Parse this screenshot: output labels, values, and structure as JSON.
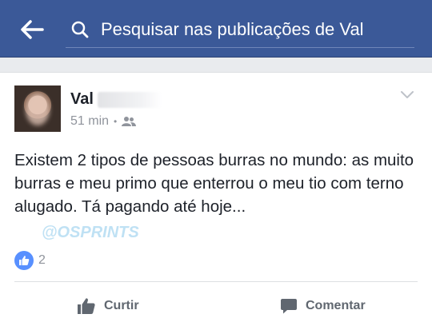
{
  "search": {
    "placeholder": "Pesquisar nas publicações de Val"
  },
  "post": {
    "author": "Val",
    "time": "51 min",
    "separator": "•",
    "text": "Existem 2 tipos de pessoas burras no mundo: as muito burras e meu primo que enterrou o meu tio com terno alugado. Tá pagando até hoje...",
    "watermark": "@OSPRINTS",
    "like_count": "2"
  },
  "actions": {
    "like_label": "Curtir",
    "comment_label": "Comentar"
  },
  "icons": {
    "back": "arrow-left-icon",
    "search": "search-icon",
    "privacy": "friends-icon",
    "menu": "chevron-down-icon",
    "reaction": "thumbs-up-icon",
    "like": "thumbs-up-icon",
    "comment": "comment-bubble-icon"
  },
  "colors": {
    "header": "#3b5998",
    "like_blue": "#5890ff",
    "text": "#1d2129",
    "meta": "#90949c"
  }
}
